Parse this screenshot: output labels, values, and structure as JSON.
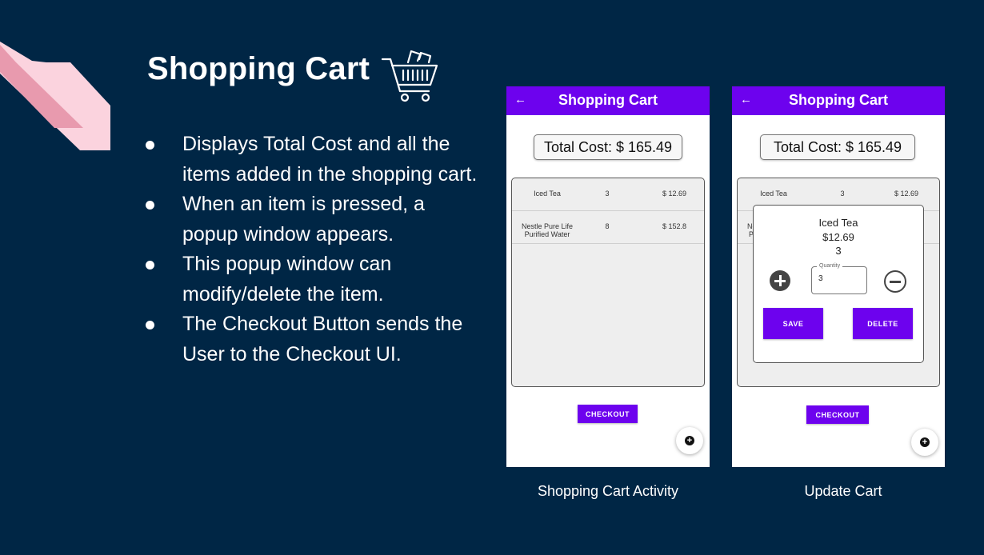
{
  "slide": {
    "title": "Shopping Cart",
    "cart_icon": "shopping-cart-icon",
    "bullets": [
      "Displays Total Cost and all the items added in the shopping cart.",
      "When an item is pressed, a popup window appears.",
      "This popup window can modify/delete the item.",
      "The Checkout Button sends the User to the Checkout UI."
    ],
    "colors": {
      "background": "#002645",
      "accent": "#6d02ee",
      "stripe_light": "#fbd3de",
      "stripe_dark": "#e89aae"
    }
  },
  "screen1": {
    "app_title": "Shopping Cart",
    "back_icon": "arrow-left-icon",
    "total_cost": "Total Cost: $ 165.49",
    "items": [
      {
        "name": "Iced Tea",
        "qty": "3",
        "price": "$ 12.69"
      },
      {
        "name": "Nestle Pure Life Purified Water",
        "qty": "8",
        "price": "$ 152.8"
      }
    ],
    "checkout_label": "CHECKOUT",
    "fab_icon": "add-circle-icon",
    "caption": "Shopping Cart Activity"
  },
  "screen2": {
    "app_title": "Shopping Cart",
    "back_icon": "arrow-left-icon",
    "total_cost": "Total Cost: $ 165.49",
    "items": [
      {
        "name": "Iced Tea",
        "qty": "3",
        "price": "$ 12.69"
      },
      {
        "name_partial_1": "Ne",
        "name_partial_2": "P"
      }
    ],
    "popup": {
      "item_name": "Iced Tea",
      "item_price": "$12.69",
      "item_qty": "3",
      "quantity_label": "Quantity",
      "quantity_value": "3",
      "save_label": "SAVE",
      "delete_label": "DELETE"
    },
    "checkout_label": "CHECKOUT",
    "fab_icon": "add-circle-icon",
    "caption": "Update Cart"
  }
}
